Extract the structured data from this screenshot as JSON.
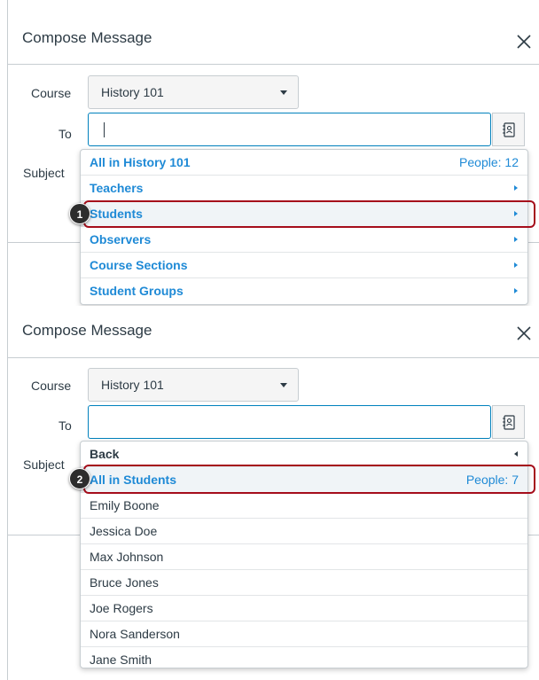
{
  "colors": {
    "accent": "#1f8ad6",
    "callout": "#a50d1b",
    "text": "#2d3b45",
    "border": "#c7cdd1"
  },
  "icons": {
    "close": "close-icon",
    "address_book": "address-book-icon",
    "caret": "chevron-down-icon"
  },
  "panel1": {
    "title": "Compose Message",
    "course_label": "Course",
    "course_value": "History 101",
    "to_label": "To",
    "subject_label": "Subject",
    "dropdown": [
      {
        "label": "All in History 101",
        "right": "People: 12"
      },
      {
        "label": "Teachers"
      },
      {
        "label": "Students"
      },
      {
        "label": "Observers"
      },
      {
        "label": "Course Sections"
      },
      {
        "label": "Student Groups"
      }
    ],
    "callout_number": "1"
  },
  "panel2": {
    "title": "Compose Message",
    "course_label": "Course",
    "course_value": "History 101",
    "to_label": "To",
    "subject_label": "Subject",
    "back_label": "Back",
    "all_label": "All in Students",
    "all_count": "People: 7",
    "people": [
      "Emily Boone",
      "Jessica Doe",
      "Max Johnson",
      "Bruce Jones",
      "Joe Rogers",
      "Nora Sanderson",
      "Jane Smith"
    ],
    "callout_number": "2"
  }
}
